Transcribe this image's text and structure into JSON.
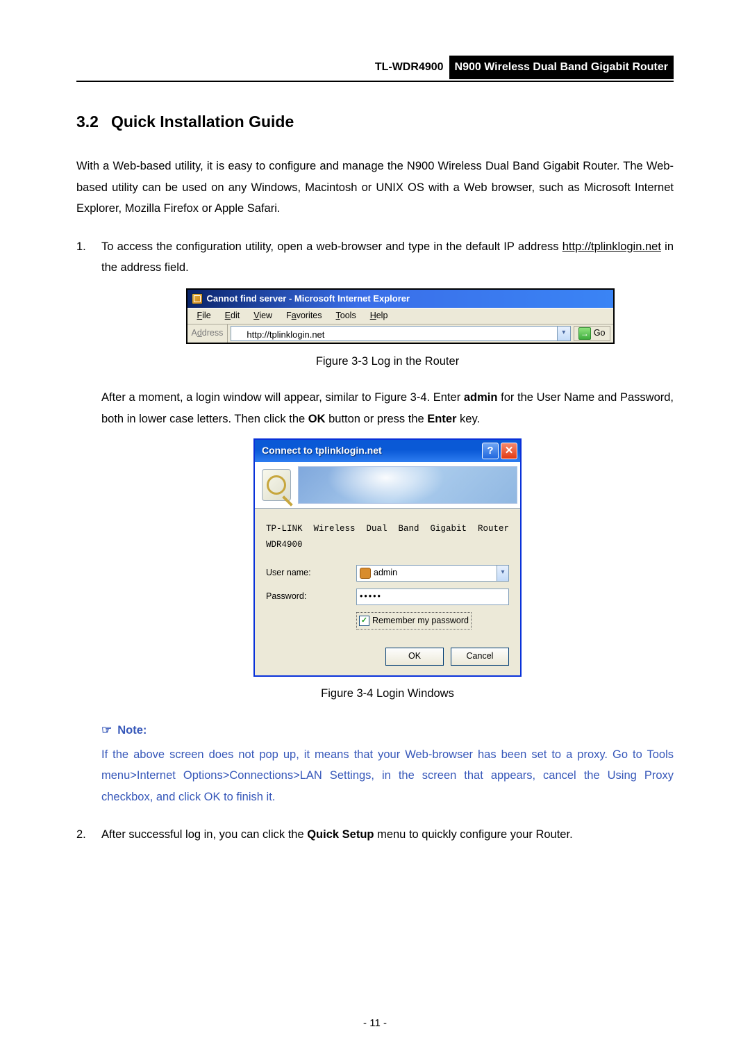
{
  "header": {
    "model": "TL-WDR4900",
    "description": "N900 Wireless Dual Band Gigabit Router"
  },
  "section": {
    "number": "3.2",
    "title": "Quick Installation Guide"
  },
  "intro": "With a Web-based utility, it is easy to configure and manage the N900 Wireless Dual Band Gigabit Router. The Web-based utility can be used on any Windows, Macintosh or UNIX OS with a Web browser, such as Microsoft Internet Explorer, Mozilla Firefox or Apple Safari.",
  "step1": {
    "num": "1.",
    "before_link": "To access the configuration utility, open a web-browser and type in the default IP address ",
    "link": "http://tplinklogin.net",
    "after_link": " in the address field."
  },
  "ie": {
    "title": "Cannot find server - Microsoft Internet Explorer",
    "menu": {
      "file": "File",
      "edit": "Edit",
      "view": "View",
      "favorites": "Favorites",
      "tools": "Tools",
      "help": "Help"
    },
    "addr_label": "Address",
    "addr_value": "http://tplinklogin.net",
    "go_label": "Go"
  },
  "fig33_caption": "Figure 3-3 Log in the Router",
  "after_fig33": {
    "t1": "After a moment, a login window will appear, similar to Figure 3-4. Enter ",
    "b1": "admin",
    "t2": " for the User Name and Password, both in lower case letters. Then click the ",
    "b2": "OK",
    "t3": " button or press the ",
    "b3": "Enter",
    "t4": " key."
  },
  "login": {
    "title": "Connect to tplinklogin.net",
    "realm": "TP-LINK Wireless Dual Band Gigabit Router WDR4900",
    "user_label": "User name:",
    "user_value": "admin",
    "pass_label": "Password:",
    "pass_value": "•••••",
    "remember": "Remember my password",
    "ok": "OK",
    "cancel": "Cancel"
  },
  "fig34_caption": "Figure 3-4 Login Windows",
  "note": {
    "label": "Note:",
    "body": "If the above screen does not pop up, it means that your Web-browser has been set to a proxy. Go to Tools menu>Internet Options>Connections>LAN Settings, in the screen that appears, cancel the Using Proxy checkbox, and click OK to finish it."
  },
  "step2": {
    "num": "2.",
    "t1": "After successful log in, you can click the ",
    "b1": "Quick Setup",
    "t2": " menu to quickly configure your Router."
  },
  "page_number": "- 11 -"
}
